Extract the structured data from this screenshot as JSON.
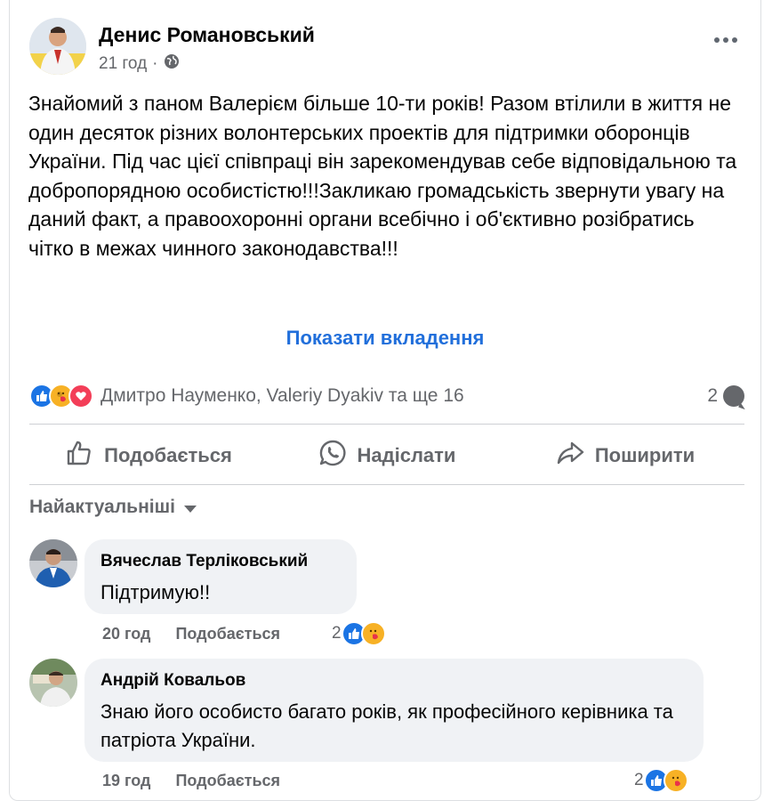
{
  "post": {
    "author": "Денис Романовський",
    "time": "21 год",
    "text": "Знайомий з паном Валерієм більше 10-ти років! Разом втілили в життя не один десяток різних волонтерських проектів для підтримки оборонців України. Під час цієї співпраці він зарекомендував себе відповідальною та добропорядною особистістю!!!Закликаю громадськість звернути увагу на даний факт, а правоохоронні органи всебічно і об'єктивно розібратись чітко в межах чинного законодавства!!!",
    "show_attachments": "Показати вкладення",
    "reactions_names": "Дмитро Науменко, Valeriy Dyakiv та ще 16",
    "comment_count": "2",
    "icons": [
      "globe-icon",
      "like-reaction-icon",
      "care-reaction-icon",
      "love-reaction-icon",
      "comment-icon"
    ]
  },
  "actions": {
    "like": "Подобається",
    "send": "Надіслати",
    "share": "Поширити"
  },
  "sort_label": "Найактуальніші",
  "comments": [
    {
      "author": "Вячеслав Терліковський",
      "text": "Підтримую!!",
      "time": "20 год",
      "like": "Подобається",
      "reaction_count": "2"
    },
    {
      "author": "Андрій Ковальов",
      "text": "Знаю його особисто багато років, як професійного керівника та патріота України.",
      "time": "19 год",
      "like": "Подобається",
      "reaction_count": "2"
    }
  ],
  "colors": {
    "accent": "#216fdb",
    "secondary_text": "#65676b",
    "like_blue": "#1b74e4",
    "love_red": "#f33e58",
    "care_yellow": "#f7b125",
    "bubble_bg": "#f0f2f5"
  }
}
